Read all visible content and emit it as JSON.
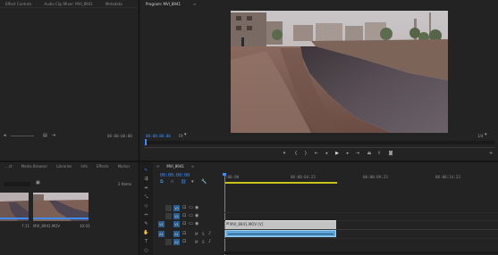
{
  "source_panel": {
    "tabs": [
      "Effect Controls",
      "Audio Clip Mixer: MVI_8941",
      "Metadata"
    ],
    "timecode": "00:00:00:00"
  },
  "program_monitor": {
    "tab": "Program: MVI_8941",
    "timecode": "00:00:00:00",
    "fit": "Fit",
    "quality": "1/4"
  },
  "project_panel": {
    "tabs": [
      "...ct",
      "Media Browser",
      "Libraries",
      "Info",
      "Effects",
      "Marker"
    ],
    "items_count": "2 Items",
    "items": [
      {
        "name": "",
        "duration": "7:11"
      },
      {
        "name": "MVI_8941.MOV",
        "duration": "10:03"
      }
    ]
  },
  "timeline": {
    "sequence_tab": "MVI_8941",
    "timecode": "00:00:00:00",
    "ruler": [
      ":00:00",
      "00:00:04:23",
      "00:00:09:23",
      "00:00:14:23"
    ],
    "video_tracks": [
      "V3",
      "V2",
      "V1"
    ],
    "audio_tracks": [
      "A1",
      "A2",
      "A3"
    ],
    "track_buttons": [
      "M",
      "S"
    ],
    "video_clip_label": "MVI_8941.MOV [V]"
  },
  "colors": {
    "accent": "#3f8cff",
    "panel": "#232323",
    "background": "#1d1d1d",
    "clip_video": "#c3c3c3",
    "clip_audio": "#5ea6d9"
  }
}
